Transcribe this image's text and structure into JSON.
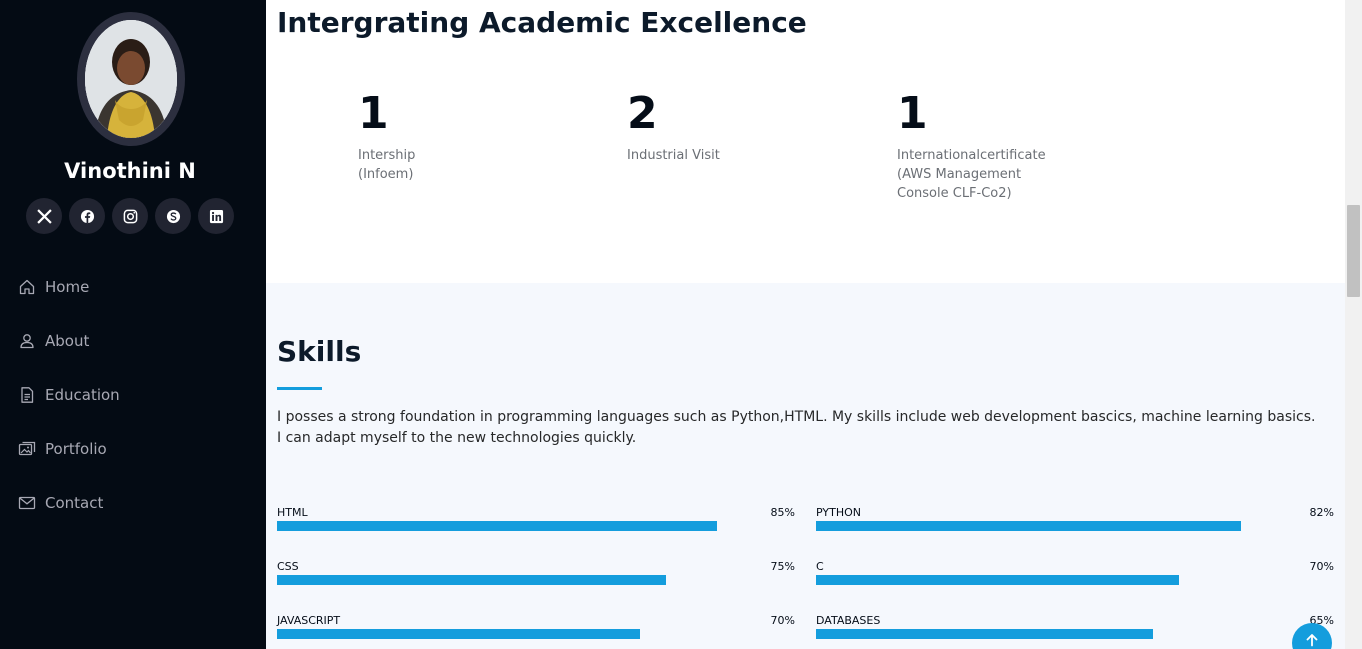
{
  "profile": {
    "name": "Vinothini N"
  },
  "social": [
    {
      "icon": "x-twitter-icon"
    },
    {
      "icon": "facebook-icon"
    },
    {
      "icon": "instagram-icon"
    },
    {
      "icon": "skype-icon"
    },
    {
      "icon": "linkedin-icon"
    }
  ],
  "nav": {
    "items": [
      {
        "label": "Home",
        "icon": "house-icon"
      },
      {
        "label": "About",
        "icon": "person-icon"
      },
      {
        "label": "Education",
        "icon": "file-text-icon"
      },
      {
        "label": "Portfolio",
        "icon": "images-icon"
      },
      {
        "label": "Contact",
        "icon": "envelope-icon"
      }
    ]
  },
  "facts": {
    "title": "Intergrating Academic Excellence",
    "items": [
      {
        "number": "1",
        "label": "Intership\n(Infoem)"
      },
      {
        "number": "2",
        "label": "Industrial Visit"
      },
      {
        "number": "1",
        "label": "Internationalcertificate\n(AWS Management\nConsole CLF-Co2)"
      }
    ]
  },
  "skills": {
    "title": "Skills",
    "description": "I posses a strong foundation in programming languages such as Python,HTML. My skills include web development bascics, machine learning basics. I can adapt myself to the new technologies quickly.",
    "items": [
      {
        "name": "HTML",
        "value": "85%",
        "percent": 85
      },
      {
        "name": "PYTHON",
        "value": "82%",
        "percent": 82
      },
      {
        "name": "CSS",
        "value": "75%",
        "percent": 75
      },
      {
        "name": "C",
        "value": "70%",
        "percent": 70
      },
      {
        "name": "JAVASCRIPT",
        "value": "70%",
        "percent": 70
      },
      {
        "name": "DATABASES",
        "value": "65%",
        "percent": 65
      }
    ]
  },
  "colors": {
    "sidebar_bg": "#040b14",
    "accent": "#149ddd",
    "skills_bg": "#f5f8fd"
  }
}
